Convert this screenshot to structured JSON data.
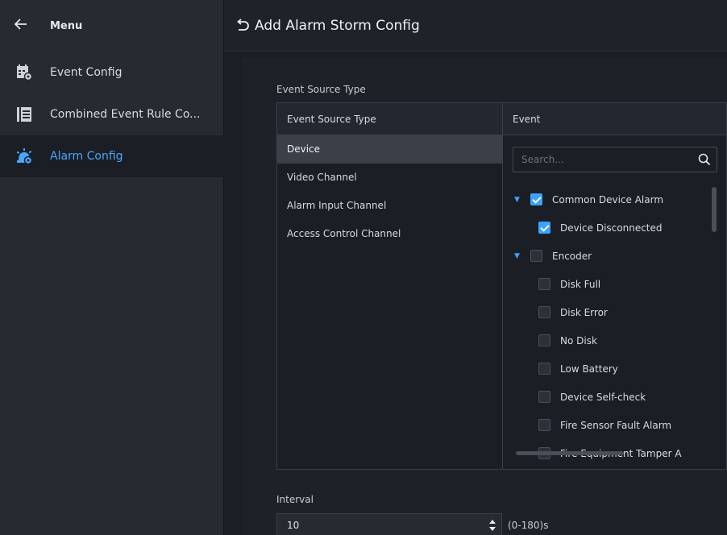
{
  "sidebar": {
    "title": "Menu",
    "back_icon": "arrow-left-icon",
    "items": [
      {
        "label": "Event Config",
        "icon": "event-config-icon",
        "active": false
      },
      {
        "label": "Combined Event Rule Co...",
        "icon": "combined-rule-icon",
        "active": false
      },
      {
        "label": "Alarm Config",
        "icon": "alarm-config-icon",
        "active": true
      }
    ]
  },
  "header": {
    "title": "Add Alarm Storm Config",
    "back_icon": "undo-icon"
  },
  "form": {
    "section_label": "Event Source Type",
    "left_column_header": "Event Source Type",
    "right_column_header": "Event",
    "source_types": [
      {
        "label": "Device",
        "selected": true
      },
      {
        "label": "Video Channel",
        "selected": false
      },
      {
        "label": "Alarm Input Channel",
        "selected": false
      },
      {
        "label": "Access Control Channel",
        "selected": false
      }
    ],
    "search": {
      "placeholder": "Search...",
      "value": ""
    },
    "events": [
      {
        "label": "Common Device Alarm",
        "level": 0,
        "expanded": true,
        "checked": true
      },
      {
        "label": "Device Disconnected",
        "level": 1,
        "checked": true
      },
      {
        "label": "Encoder",
        "level": 0,
        "expanded": true,
        "checked": false
      },
      {
        "label": "Disk Full",
        "level": 1,
        "checked": false
      },
      {
        "label": "Disk Error",
        "level": 1,
        "checked": false
      },
      {
        "label": "No Disk",
        "level": 1,
        "checked": false
      },
      {
        "label": "Low Battery",
        "level": 1,
        "checked": false
      },
      {
        "label": "Device Self-check",
        "level": 1,
        "checked": false
      },
      {
        "label": "Fire Sensor Fault Alarm",
        "level": 1,
        "checked": false
      },
      {
        "label": "Fire Equipment Tamper A",
        "level": 1,
        "checked": false
      }
    ],
    "interval": {
      "label": "Interval",
      "value": "10",
      "range": "(0-180)s"
    }
  },
  "colors": {
    "accent": "#3aa2ff",
    "background": "#1b1e24",
    "sidebar": "#262a31"
  }
}
